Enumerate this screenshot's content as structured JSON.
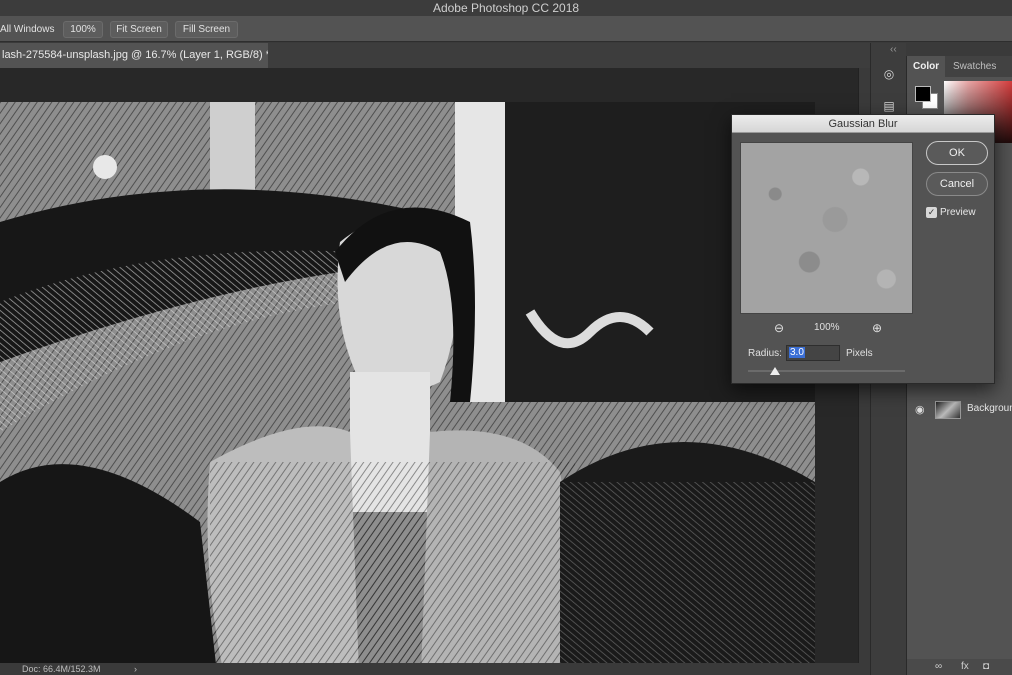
{
  "app": {
    "title": "Adobe Photoshop CC 2018"
  },
  "options_bar": {
    "all_windows": "All Windows",
    "zoom_button": "100%",
    "fit_screen": "Fit Screen",
    "fill_screen": "Fill Screen"
  },
  "document": {
    "tab_label": "lash-275584-unsplash.jpg @ 16.7% (Layer 1, RGB/8) *"
  },
  "status_bar": {
    "doc_info": "Doc: 66.4M/152.3M",
    "arrow": "›"
  },
  "panels": {
    "color_tab": "Color",
    "swatches_tab": "Swatches",
    "foreground_color": "#000000",
    "background_color": "#ffffff",
    "layer_name": "Background",
    "footer_icons": [
      "∞",
      "fx",
      "◘"
    ]
  },
  "dialog": {
    "title": "Gaussian Blur",
    "ok": "OK",
    "cancel": "Cancel",
    "preview_label": "Preview",
    "preview_checked": true,
    "zoom_out_icon": "⊖",
    "zoom_level": "100%",
    "zoom_in_icon": "⊕",
    "radius_label": "Radius:",
    "radius_value": "3.0",
    "radius_unit": "Pixels"
  }
}
